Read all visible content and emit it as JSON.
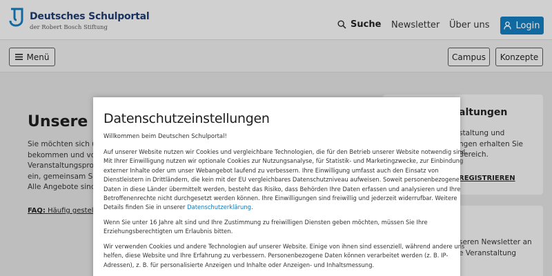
{
  "header": {
    "brand_title": "Deutsches Schulportal",
    "brand_subtitle": "der Robert Bosch Stiftung",
    "nav": {
      "search_label": "Suche",
      "newsletter_label": "Newsletter",
      "about_label": "Über uns",
      "login_label": "Login"
    },
    "menu_label": "Menü",
    "campus_label": "Campus",
    "konzepte_label": "Konzepte"
  },
  "page": {
    "heading": "Unsere F",
    "intro_lines": [
      "Sie möchten sich übe",
      "bekommen und von I",
      "Veranstaltungsprog",
      "ein, gemeinsam Schu",
      "Alle Angebote sind k"
    ],
    "faq_label": "FAQ:",
    "faq_text": "Häufig gestellte",
    "card1": {
      "title": "altungen",
      "lines": [
        "staltung und",
        "ngen erhalten Sie",
        "Bereich."
      ],
      "link": "REGISTRIEREN"
    },
    "card2": {
      "lines": [
        "seren Newsletter an",
        "e Veranstaltung"
      ]
    }
  },
  "modal": {
    "title": "Datenschutzeinstellungen",
    "welcome": "Willkommen beim Deutschen Schulportal!",
    "p1_lines": [
      "Auf unserer Website nutzen wir Cookies und vergleichbare Technologien, die für den Betrieb unserer Website notwendig sind.",
      "Mit Ihrer Einwilligung nutzen wir optionale Cookies zur Nutzungsanalyse, für Statistik- und Marketingzwecke, zur Einbindung",
      "externer Inhalte oder um unser Webangebot laufend zu verbessern. Ihre Einwilligung umfasst auch den Einsatz von",
      "Dienstleistern in Drittländern, die kein mit der EU vergleichbares Datenschutzniveau aufweisen. Soweit personenbezogene",
      "Daten in diese Länder übermittelt werden, besteht das Risiko, dass Behörden Ihre Daten erfassen und analysieren und Ihre",
      "Betroffenenrechte nicht durchgesetzt werden können. Ihre Einwilligungen sind freiwillig und jederzeit widerrufbar. Weitere"
    ],
    "p1_last_prefix": "Details finden Sie in unserer ",
    "p1_link": "Datenschutzerklärung",
    "p1_last_suffix": ".",
    "p2_lines": [
      "Wenn Sie unter 16 Jahre alt sind und Ihre Zustimmung zu freiwilligen Diensten geben möchten, müssen Sie Ihre",
      "Erziehungsberechtigten um Erlaubnis bitten."
    ],
    "p3_lines": [
      "Wir verwenden Cookies und andere Technologien auf unserer Website. Einige von ihnen sind essenziell, während andere uns",
      "helfen, diese Website und Ihre Erfahrung zu verbessern. Personenbezogene Daten können verarbeitet werden (z. B. IP-",
      "Adressen), z. B. für personalisierte Anzeigen und Inhalte oder Anzeigen- und Inhaltsmessung."
    ]
  },
  "colors": {
    "brand_blue": "#1478b8",
    "brand_navy": "#1d3a6e"
  }
}
